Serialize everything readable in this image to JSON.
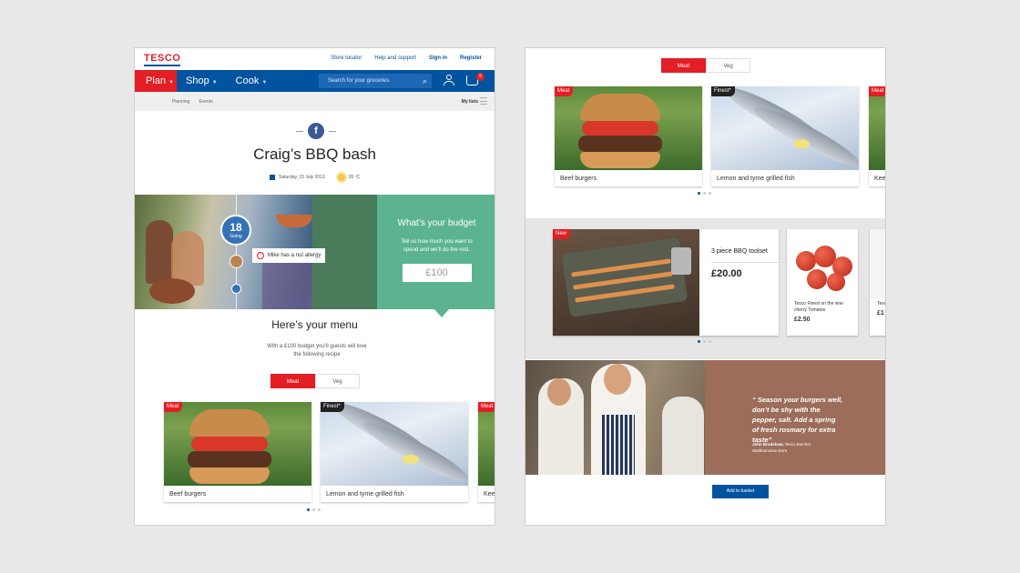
{
  "left_screen": {
    "logo": "TESCO",
    "top_links": [
      "Store locator",
      "Help and support",
      "Sign in",
      "Register"
    ],
    "nav": {
      "plan": "Plan",
      "shop": "Shop",
      "cook": "Cook"
    },
    "search_placeholder": "Search for your groceries",
    "basket_count": "9",
    "breadcrumb": [
      "Planning",
      "Events"
    ],
    "my_lists": "My lists",
    "event": {
      "title": "Craig’s BBQ bash",
      "date": "Saturday, 15 July 2013",
      "temperature": "26 ºC"
    },
    "going_count": "18",
    "going_label": "Going",
    "allergy_note": "Mike has a nut allergy",
    "budget": {
      "heading": "What’s your budget",
      "description": "Tell us how much you want to spend and we’ll do the rest.",
      "value": "£100"
    },
    "menu": {
      "heading": "Here’s your menu",
      "description": "With a £100 budget you’ll guests will love the following recipe"
    },
    "tabs": [
      "Meat",
      "Veg"
    ],
    "recipes": [
      {
        "tag": "Meat",
        "name": "Beef burgers"
      },
      {
        "tag": "Finest*",
        "name": "Lemon and tyme grilled fish"
      },
      {
        "tag": "Meat",
        "name": "Kee"
      }
    ]
  },
  "right_screen": {
    "tabs": [
      "Meat",
      "Veg"
    ],
    "recipes": [
      {
        "tag": "Meat",
        "name": "Beef burgers"
      },
      {
        "tag": "Finest*",
        "name": "Lemon and tyme grilled fish"
      },
      {
        "tag": "Meat",
        "name": "Kee"
      }
    ],
    "product": {
      "tag": "New",
      "name": "3 piece BBQ toolset",
      "price": "£20.00",
      "button": "Add to basket"
    },
    "product2": {
      "name": "Tesco Finest on the vine cherry Tomatoe",
      "price": "£2.50"
    },
    "product3": {
      "name": "Tesc",
      "price": "£1"
    },
    "quote": {
      "text": "“ Season your burgers well, don’t be shy with the pepper, salt. Add a spring of fresh rosmary for extra taste”",
      "author": "John Bradshaw,",
      "author_role": "Tesco Butcher",
      "store": "Walthamstow store"
    }
  },
  "colors": {
    "tesco_red": "#e31e24",
    "tesco_blue": "#00539f",
    "budget_green": "#5bb48f",
    "quote_brown": "#9c6d5a"
  }
}
